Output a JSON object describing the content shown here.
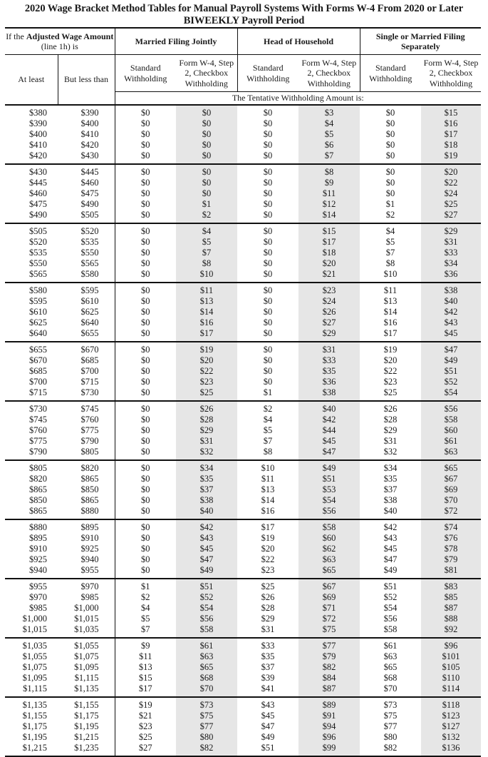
{
  "title_line1": "2020 Wage Bracket Method Tables for Manual Payroll Systems With Forms W-4 From 2020 or Later",
  "title_line2": "BIWEEKLY Payroll Period",
  "header": {
    "wage_prefix": "If the ",
    "wage_bold": "Adjusted Wage Amount",
    "wage_suffix": " (line 1h) is",
    "groups": [
      "Married Filing Jointly",
      "Head of Household",
      "Single or Married Filing Separately"
    ],
    "at_least": "At least",
    "but_less_than": "But less than",
    "standard": "Standard Withholding",
    "checkbox": "Form W-4, Step 2, Checkbox Withholding",
    "tentative": "The Tentative Withholding Amount is:"
  },
  "rows": [
    [
      "$380",
      "$390",
      "$0",
      "$0",
      "$0",
      "$3",
      "$0",
      "$15"
    ],
    [
      "$390",
      "$400",
      "$0",
      "$0",
      "$0",
      "$4",
      "$0",
      "$16"
    ],
    [
      "$400",
      "$410",
      "$0",
      "$0",
      "$0",
      "$5",
      "$0",
      "$17"
    ],
    [
      "$410",
      "$420",
      "$0",
      "$0",
      "$0",
      "$6",
      "$0",
      "$18"
    ],
    [
      "$420",
      "$430",
      "$0",
      "$0",
      "$0",
      "$7",
      "$0",
      "$19"
    ],
    [
      "$430",
      "$445",
      "$0",
      "$0",
      "$0",
      "$8",
      "$0",
      "$20"
    ],
    [
      "$445",
      "$460",
      "$0",
      "$0",
      "$0",
      "$9",
      "$0",
      "$22"
    ],
    [
      "$460",
      "$475",
      "$0",
      "$0",
      "$0",
      "$11",
      "$0",
      "$24"
    ],
    [
      "$475",
      "$490",
      "$0",
      "$1",
      "$0",
      "$12",
      "$1",
      "$25"
    ],
    [
      "$490",
      "$505",
      "$0",
      "$2",
      "$0",
      "$14",
      "$2",
      "$27"
    ],
    [
      "$505",
      "$520",
      "$0",
      "$4",
      "$0",
      "$15",
      "$4",
      "$29"
    ],
    [
      "$520",
      "$535",
      "$0",
      "$5",
      "$0",
      "$17",
      "$5",
      "$31"
    ],
    [
      "$535",
      "$550",
      "$0",
      "$7",
      "$0",
      "$18",
      "$7",
      "$33"
    ],
    [
      "$550",
      "$565",
      "$0",
      "$8",
      "$0",
      "$20",
      "$8",
      "$34"
    ],
    [
      "$565",
      "$580",
      "$0",
      "$10",
      "$0",
      "$21",
      "$10",
      "$36"
    ],
    [
      "$580",
      "$595",
      "$0",
      "$11",
      "$0",
      "$23",
      "$11",
      "$38"
    ],
    [
      "$595",
      "$610",
      "$0",
      "$13",
      "$0",
      "$24",
      "$13",
      "$40"
    ],
    [
      "$610",
      "$625",
      "$0",
      "$14",
      "$0",
      "$26",
      "$14",
      "$42"
    ],
    [
      "$625",
      "$640",
      "$0",
      "$16",
      "$0",
      "$27",
      "$16",
      "$43"
    ],
    [
      "$640",
      "$655",
      "$0",
      "$17",
      "$0",
      "$29",
      "$17",
      "$45"
    ],
    [
      "$655",
      "$670",
      "$0",
      "$19",
      "$0",
      "$31",
      "$19",
      "$47"
    ],
    [
      "$670",
      "$685",
      "$0",
      "$20",
      "$0",
      "$33",
      "$20",
      "$49"
    ],
    [
      "$685",
      "$700",
      "$0",
      "$22",
      "$0",
      "$35",
      "$22",
      "$51"
    ],
    [
      "$700",
      "$715",
      "$0",
      "$23",
      "$0",
      "$36",
      "$23",
      "$52"
    ],
    [
      "$715",
      "$730",
      "$0",
      "$25",
      "$1",
      "$38",
      "$25",
      "$54"
    ],
    [
      "$730",
      "$745",
      "$0",
      "$26",
      "$2",
      "$40",
      "$26",
      "$56"
    ],
    [
      "$745",
      "$760",
      "$0",
      "$28",
      "$4",
      "$42",
      "$28",
      "$58"
    ],
    [
      "$760",
      "$775",
      "$0",
      "$29",
      "$5",
      "$44",
      "$29",
      "$60"
    ],
    [
      "$775",
      "$790",
      "$0",
      "$31",
      "$7",
      "$45",
      "$31",
      "$61"
    ],
    [
      "$790",
      "$805",
      "$0",
      "$32",
      "$8",
      "$47",
      "$32",
      "$63"
    ],
    [
      "$805",
      "$820",
      "$0",
      "$34",
      "$10",
      "$49",
      "$34",
      "$65"
    ],
    [
      "$820",
      "$865",
      "$0",
      "$35",
      "$11",
      "$51",
      "$35",
      "$67"
    ],
    [
      "$865",
      "$850",
      "$0",
      "$37",
      "$13",
      "$53",
      "$37",
      "$69"
    ],
    [
      "$850",
      "$865",
      "$0",
      "$38",
      "$14",
      "$54",
      "$38",
      "$70"
    ],
    [
      "$865",
      "$880",
      "$0",
      "$40",
      "$16",
      "$56",
      "$40",
      "$72"
    ],
    [
      "$880",
      "$895",
      "$0",
      "$42",
      "$17",
      "$58",
      "$42",
      "$74"
    ],
    [
      "$895",
      "$910",
      "$0",
      "$43",
      "$19",
      "$60",
      "$43",
      "$76"
    ],
    [
      "$910",
      "$925",
      "$0",
      "$45",
      "$20",
      "$62",
      "$45",
      "$78"
    ],
    [
      "$925",
      "$940",
      "$0",
      "$47",
      "$22",
      "$63",
      "$47",
      "$79"
    ],
    [
      "$940",
      "$955",
      "$0",
      "$49",
      "$23",
      "$65",
      "$49",
      "$81"
    ],
    [
      "$955",
      "$970",
      "$1",
      "$51",
      "$25",
      "$67",
      "$51",
      "$83"
    ],
    [
      "$970",
      "$985",
      "$2",
      "$52",
      "$26",
      "$69",
      "$52",
      "$85"
    ],
    [
      "$985",
      "$1,000",
      "$4",
      "$54",
      "$28",
      "$71",
      "$54",
      "$87"
    ],
    [
      "$1,000",
      "$1,015",
      "$5",
      "$56",
      "$29",
      "$72",
      "$56",
      "$88"
    ],
    [
      "$1,015",
      "$1,035",
      "$7",
      "$58",
      "$31",
      "$75",
      "$58",
      "$92"
    ],
    [
      "$1,035",
      "$1,055",
      "$9",
      "$61",
      "$33",
      "$77",
      "$61",
      "$96"
    ],
    [
      "$1,055",
      "$1,075",
      "$11",
      "$63",
      "$35",
      "$79",
      "$63",
      "$101"
    ],
    [
      "$1,075",
      "$1,095",
      "$13",
      "$65",
      "$37",
      "$82",
      "$65",
      "$105"
    ],
    [
      "$1,095",
      "$1,115",
      "$15",
      "$68",
      "$39",
      "$84",
      "$68",
      "$110"
    ],
    [
      "$1,115",
      "$1,135",
      "$17",
      "$70",
      "$41",
      "$87",
      "$70",
      "$114"
    ],
    [
      "$1,135",
      "$1,155",
      "$19",
      "$73",
      "$43",
      "$89",
      "$73",
      "$118"
    ],
    [
      "$1,155",
      "$1,175",
      "$21",
      "$75",
      "$45",
      "$91",
      "$75",
      "$123"
    ],
    [
      "$1,175",
      "$1,195",
      "$23",
      "$77",
      "$47",
      "$94",
      "$77",
      "$127"
    ],
    [
      "$1,195",
      "$1,215",
      "$25",
      "$80",
      "$49",
      "$96",
      "$80",
      "$132"
    ],
    [
      "$1,215",
      "$1,235",
      "$27",
      "$82",
      "$51",
      "$99",
      "$82",
      "$136"
    ]
  ]
}
